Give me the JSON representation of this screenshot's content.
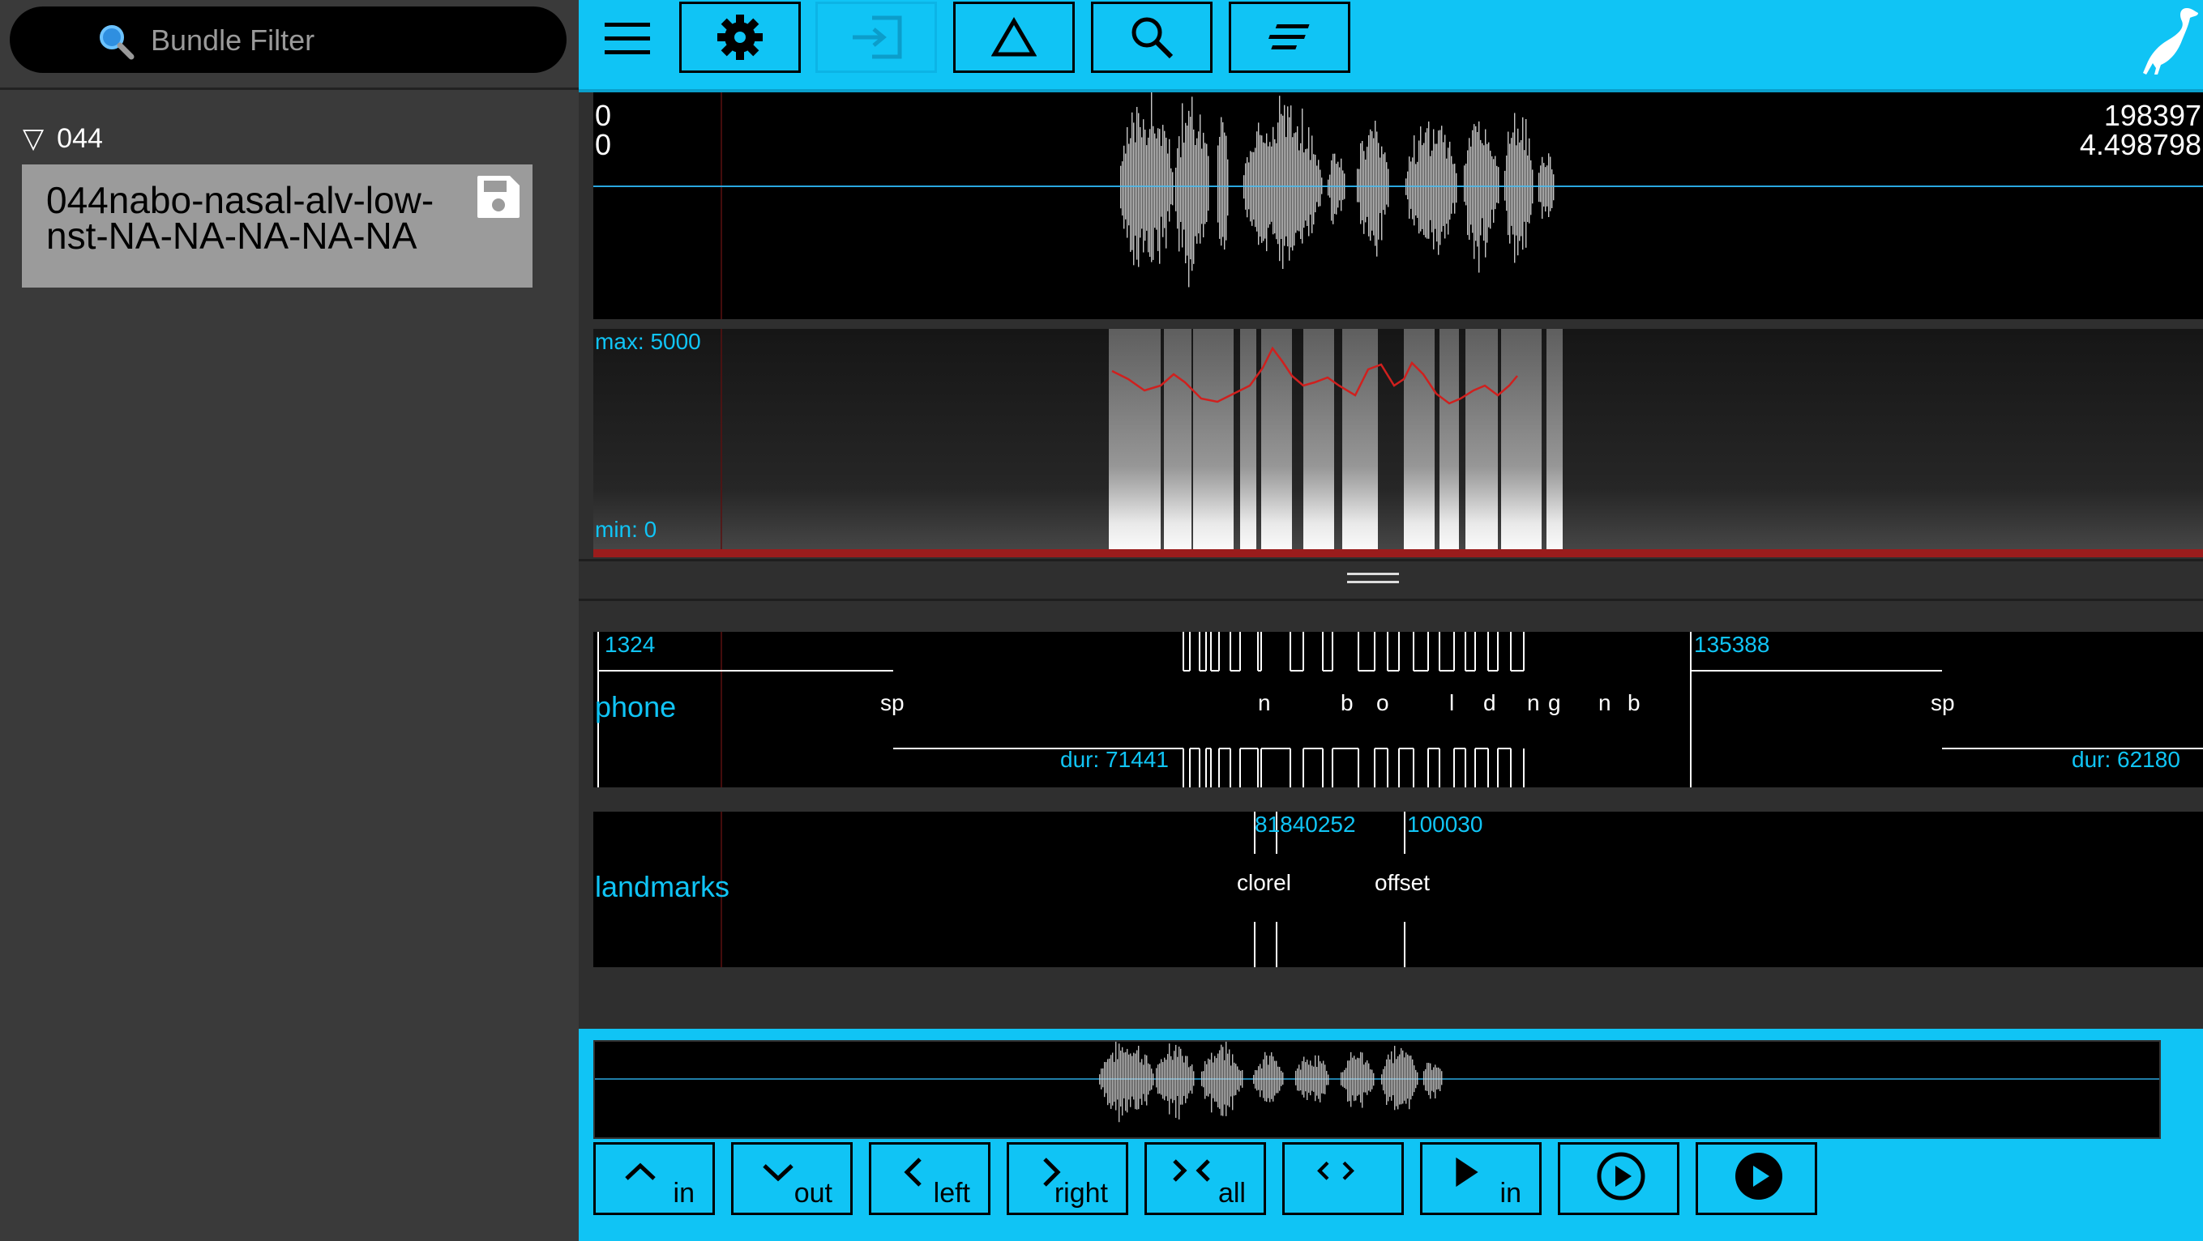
{
  "sidebar": {
    "filter_placeholder": "Bundle Filter",
    "session": {
      "toggle": "▽",
      "name": "044"
    },
    "bundle": {
      "name_line1": "044nabo-nasal-alv-low-",
      "name_line2": "nst-NA-NA-NA-NA-NA"
    }
  },
  "waveform": {
    "start_sample": "0",
    "start_time": "0",
    "end_sample": "198397",
    "end_time": "4.498798"
  },
  "spectrogram": {
    "max_label": "max: 5000",
    "min_label": "min: 0"
  },
  "phone_level": {
    "name": "phone",
    "left_time": "1324",
    "right_time": "135388",
    "left_dur": "dur: 71441",
    "right_dur": "dur: 62180",
    "segments": [
      "sp",
      "n",
      "b",
      "o",
      "l",
      "d",
      "n",
      "g",
      "n",
      "b",
      "sp"
    ]
  },
  "landmarks_level": {
    "name": "landmarks",
    "times": [
      "81840252",
      "100030"
    ],
    "labels": [
      "clorel",
      "offset"
    ]
  },
  "bottom_buttons": [
    "in",
    "out",
    "left",
    "right",
    "all",
    "",
    "in",
    "",
    ""
  ],
  "colors": {
    "accent": "#10c4f5",
    "formant": "#d0201e"
  }
}
